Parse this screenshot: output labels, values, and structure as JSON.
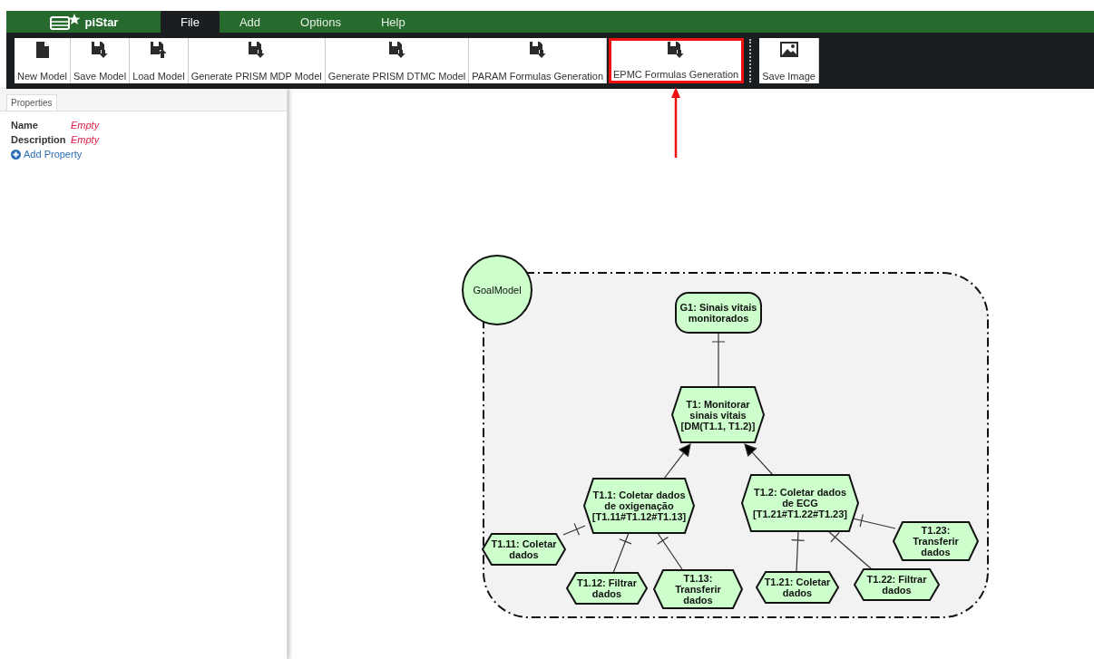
{
  "app": {
    "name": "piStar"
  },
  "menu": [
    {
      "label": "File",
      "selected": true
    },
    {
      "label": "Add",
      "selected": false
    },
    {
      "label": "Options",
      "selected": false
    },
    {
      "label": "Help",
      "selected": false
    }
  ],
  "toolbar": [
    {
      "label": "New Model",
      "kind": "new",
      "highlighted": false
    },
    {
      "label": "Save Model",
      "kind": "save",
      "highlighted": false
    },
    {
      "label": "Load Model",
      "kind": "load",
      "highlighted": false
    },
    {
      "label": "Generate PRISM MDP Model",
      "kind": "save",
      "highlighted": false
    },
    {
      "label": "Generate PRISM DTMC Model",
      "kind": "save",
      "highlighted": false
    },
    {
      "label": "PARAM Formulas Generation",
      "kind": "save",
      "highlighted": false
    },
    {
      "label": "EPMC Formulas Generation",
      "kind": "save",
      "highlighted": true
    },
    {
      "label": "Save Image",
      "kind": "image",
      "highlighted": false
    }
  ],
  "properties": {
    "tab": "Properties",
    "rows": [
      {
        "name": "Name",
        "value": "Empty"
      },
      {
        "name": "Description",
        "value": "Empty"
      }
    ],
    "add": "Add Property"
  },
  "diagram": {
    "actor": "GoalModel",
    "nodes": [
      {
        "kind": "goal",
        "lines": [
          "G1: Sinais vitais",
          "monitorados"
        ]
      },
      {
        "kind": "task",
        "lines": [
          "T1: Monitorar",
          "sinais vitais",
          "[DM(T1.1, T1.2)]"
        ],
        "link": {
          "kind": "bar"
        }
      },
      {
        "kind": "task",
        "lines": [
          "T1.1: Coletar dados",
          "de oxigenação",
          "[T1.11#T1.12#T1.13]"
        ],
        "link": {
          "kind": "arrow"
        }
      },
      {
        "kind": "task",
        "lines": [
          "T1.11: Coletar",
          "dados"
        ],
        "link": {
          "kind": "bar"
        }
      },
      {
        "kind": "task",
        "lines": [
          "T1.12: Filtrar",
          "dados"
        ],
        "link": {
          "kind": "bar"
        }
      },
      {
        "kind": "task",
        "lines": [
          "T1.13:",
          "Transferir",
          "dados"
        ],
        "link": {
          "kind": "bar"
        }
      },
      {
        "kind": "task",
        "lines": [
          "T1.2: Coletar dados",
          "de ECG",
          "[T1.21#T1.22#T1.23]"
        ],
        "link": {
          "kind": "arrow"
        }
      },
      {
        "kind": "task",
        "lines": [
          "T1.21: Coletar",
          "dados"
        ],
        "link": {
          "kind": "bar"
        }
      },
      {
        "kind": "task",
        "lines": [
          "T1.22: Filtrar",
          "dados"
        ],
        "link": {
          "kind": "bar"
        }
      },
      {
        "kind": "task",
        "lines": [
          "T1.23:",
          "Transferir",
          "dados"
        ],
        "link": {
          "kind": "bar"
        }
      }
    ]
  }
}
